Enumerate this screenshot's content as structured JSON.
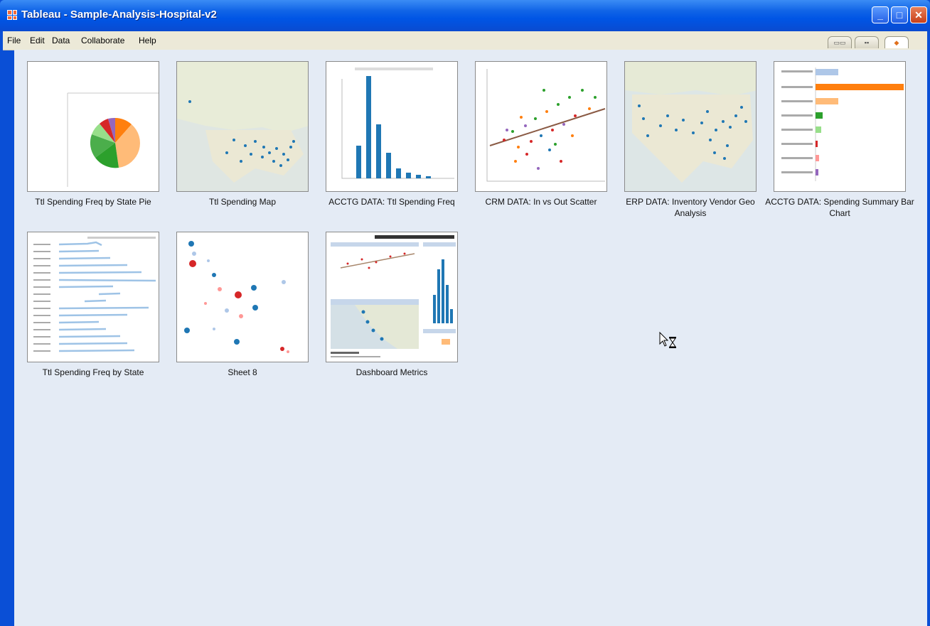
{
  "window": {
    "title": "Tableau - Sample-Analysis-Hospital-v2",
    "controls": {
      "minimize": "_",
      "maximize": "□",
      "close": "✕"
    }
  },
  "menu": [
    "File",
    "Edit",
    "Data",
    "Collaborate",
    "Help"
  ],
  "view_tabs": [
    {
      "label": "▭▭",
      "icon": "filmstrip-icon"
    },
    {
      "label": "▪▪",
      "icon": "sheet-sorter-icon"
    },
    {
      "label": "◆",
      "icon": "home-icon"
    }
  ],
  "sheets": [
    {
      "label": "Ttl Spending Freq by State Pie"
    },
    {
      "label": "Ttl Spending Map"
    },
    {
      "label": "ACCTG DATA: Ttl Spending Freq"
    },
    {
      "label": "CRM DATA: In vs Out Scatter"
    },
    {
      "label": "ERP DATA: Inventory Vendor Geo Analysis"
    },
    {
      "label": "ACCTG DATA: Spending Summary Bar Chart"
    },
    {
      "label": "Ttl Spending Freq by State"
    },
    {
      "label": "Sheet 8"
    },
    {
      "label": "Dashboard Metrics"
    }
  ],
  "colors": {
    "titlebar": "#0055e5",
    "content_bg": "#e4ebf5",
    "tableau_blue": "#1f77b4",
    "tableau_orange": "#ff7f0e",
    "tableau_green": "#2ca02c",
    "tableau_red": "#d62728"
  }
}
